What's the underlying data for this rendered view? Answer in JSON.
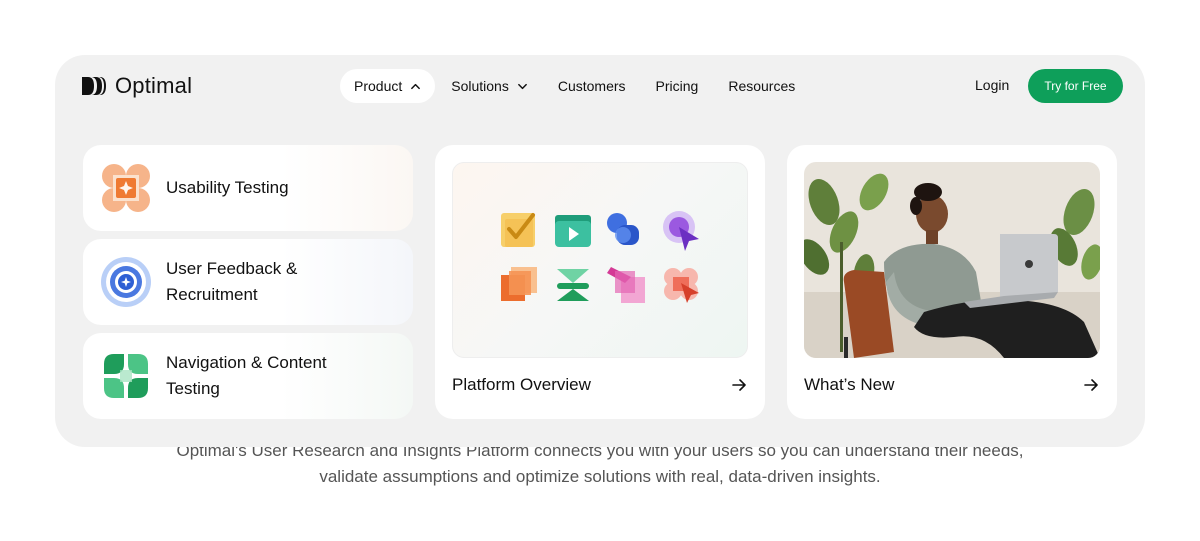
{
  "body_text": {
    "line1": "Optimal's User Research and Insights Platform connects you with your users so you can understand their needs,",
    "line2": "validate assumptions and optimize solutions with real, data-driven insights."
  },
  "brand": {
    "name": "Optimal",
    "accent": "#0e9f5a"
  },
  "nav": {
    "items": [
      {
        "label": "Product",
        "icon": "chevron-up-icon",
        "active": true
      },
      {
        "label": "Solutions",
        "icon": "chevron-down-icon",
        "active": false
      },
      {
        "label": "Customers"
      },
      {
        "label": "Pricing"
      },
      {
        "label": "Resources"
      }
    ],
    "login_label": "Login",
    "cta_label": "Try for Free"
  },
  "product_menu": {
    "products": [
      {
        "label": "Usability Testing",
        "icon": "usability-testing-icon"
      },
      {
        "label": "User Feedback & Recruitment",
        "icon": "user-feedback-icon"
      },
      {
        "label": "Navigation & Content Testing",
        "icon": "navigation-testing-icon"
      }
    ],
    "platform_overview": {
      "label": "Platform Overview",
      "icon": "arrow-right-icon"
    },
    "whats_new": {
      "label": "What’s New",
      "icon": "arrow-right-icon"
    }
  }
}
